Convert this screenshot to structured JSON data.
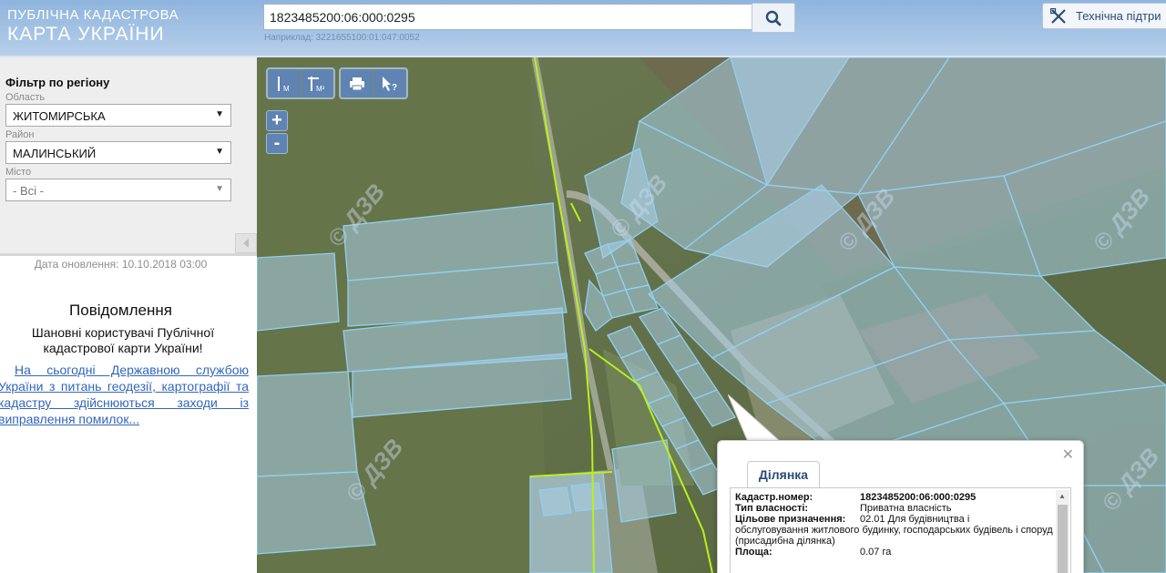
{
  "header": {
    "logo_line1": "ПУБЛІЧНА КАДАСТРОВА",
    "logo_line2": "КАРТА УКРАЇНИ",
    "search_value": "1823485200:06:000:0295",
    "search_hint": "Наприклад: 3221655100:01:047:0052",
    "support_label": "Технічна підтри"
  },
  "sidebar": {
    "filter_title": "Фільтр по регіону",
    "oblast_label": "Область",
    "oblast_value": "ЖИТОМИРСЬКА",
    "rayon_label": "Район",
    "rayon_value": "МАЛИНСЬКИЙ",
    "city_label": "Місто",
    "city_value": "- Всі -",
    "update_date": "Дата оновлення: 10.10.2018 03:00",
    "notice_title": "Повідомлення",
    "notice_body": "Шановні користувачі Публічної кадастрової карти України!",
    "notice_link": "На сьогодні Державною службою України з питань геодезії, картографії та кадастру здійснюються заходи із виправлення помилок..."
  },
  "map": {
    "watermark": "© ДЗВ",
    "tools": {
      "measure_m": "M",
      "measure_m2": "M²"
    },
    "zoom_in": "+",
    "zoom_out": "-"
  },
  "popup": {
    "tab": "Ділянка",
    "cadastr_label": "Кадастр.номер:",
    "cadastr_value": "1823485200:06:000:0295",
    "ownership_label": "Тип власності:",
    "ownership_value": "Приватна власність",
    "purpose_label": "Цільове призначення:",
    "purpose_value": "02.01 Для будівництва і",
    "purpose_cont": "обслуговування житлового будинку, господарських будівель і споруд (присадибна ділянка)",
    "area_label": "Площа:",
    "area_value": "0.07 га"
  },
  "colors": {
    "header_top": "#8fb4dd",
    "parcel_fill": "#a9cfe8",
    "parcel_stroke": "#8fd0f0",
    "boundary": "#b9f01f",
    "link": "#3366bb"
  }
}
